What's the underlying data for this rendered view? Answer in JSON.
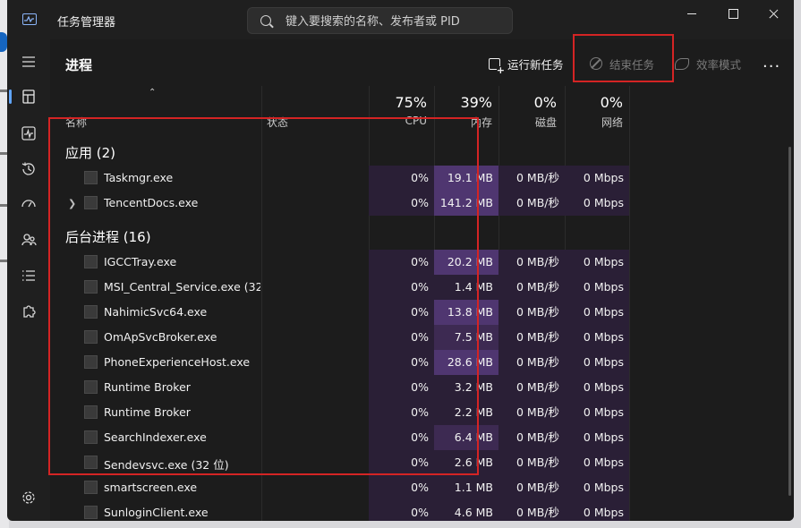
{
  "app": {
    "title": "任务管理器"
  },
  "search": {
    "placeholder": "键入要搜索的名称、发布者或 PID"
  },
  "toolbar": {
    "page_title": "进程",
    "run_new_task": "运行新任务",
    "end_task": "结束任务",
    "efficiency_mode": "效率模式",
    "more": "..."
  },
  "columns": {
    "name": "名称",
    "status": "状态",
    "cpu_pct": "75%",
    "cpu": "CPU",
    "mem_pct": "39%",
    "mem": "内存",
    "disk_pct": "0%",
    "disk": "磁盘",
    "net_pct": "0%",
    "net": "网络"
  },
  "groups": {
    "apps": "应用 (2)",
    "background": "后台进程 (16)"
  },
  "apps": [
    {
      "name": "Taskmgr.exe",
      "cpu": "0%",
      "mem": "19.1 MB",
      "disk": "0 MB/秒",
      "net": "0 Mbps",
      "expandable": false,
      "mem_level": 0.55
    },
    {
      "name": "TencentDocs.exe",
      "cpu": "0%",
      "mem": "141.2 MB",
      "disk": "0 MB/秒",
      "net": "0 Mbps",
      "expandable": true,
      "mem_level": 0.7
    }
  ],
  "background": [
    {
      "name": "IGCCTray.exe",
      "cpu": "0%",
      "mem": "20.2 MB",
      "disk": "0 MB/秒",
      "net": "0 Mbps",
      "mem_level": 0.55
    },
    {
      "name": "MSI_Central_Service.exe (32...",
      "cpu": "0%",
      "mem": "1.4 MB",
      "disk": "0 MB/秒",
      "net": "0 Mbps",
      "mem_level": 0.1
    },
    {
      "name": "NahimicSvc64.exe",
      "cpu": "0%",
      "mem": "13.8 MB",
      "disk": "0 MB/秒",
      "net": "0 Mbps",
      "mem_level": 0.5
    },
    {
      "name": "OmApSvcBroker.exe",
      "cpu": "0%",
      "mem": "7.5 MB",
      "disk": "0 MB/秒",
      "net": "0 Mbps",
      "mem_level": 0.2
    },
    {
      "name": "PhoneExperienceHost.exe",
      "cpu": "0%",
      "mem": "28.6 MB",
      "disk": "0 MB/秒",
      "net": "0 Mbps",
      "mem_level": 0.6
    },
    {
      "name": "Runtime Broker",
      "cpu": "0%",
      "mem": "3.2 MB",
      "disk": "0 MB/秒",
      "net": "0 Mbps",
      "mem_level": 0.1
    },
    {
      "name": "Runtime Broker",
      "cpu": "0%",
      "mem": "2.2 MB",
      "disk": "0 MB/秒",
      "net": "0 Mbps",
      "mem_level": 0.1
    },
    {
      "name": "SearchIndexer.exe",
      "cpu": "0%",
      "mem": "6.4 MB",
      "disk": "0 MB/秒",
      "net": "0 Mbps",
      "mem_level": 0.2
    },
    {
      "name": "Sendevsvc.exe (32 位)",
      "cpu": "0%",
      "mem": "2.6 MB",
      "disk": "0 MB/秒",
      "net": "0 Mbps",
      "mem_level": 0.1
    },
    {
      "name": "smartscreen.exe",
      "cpu": "0%",
      "mem": "1.1 MB",
      "disk": "0 MB/秒",
      "net": "0 Mbps",
      "mem_level": 0.1
    },
    {
      "name": "SunloginClient.exe",
      "cpu": "0%",
      "mem": "4.6 MB",
      "disk": "0 MB/秒",
      "net": "0 Mbps",
      "mem_level": 0.1
    }
  ],
  "colors": {
    "accent": "#60a5fa",
    "highlight_box": "#d42424",
    "heat_low": "#2a1f36",
    "heat_mid": "#3d2a52",
    "heat_high": "#4f3670"
  }
}
